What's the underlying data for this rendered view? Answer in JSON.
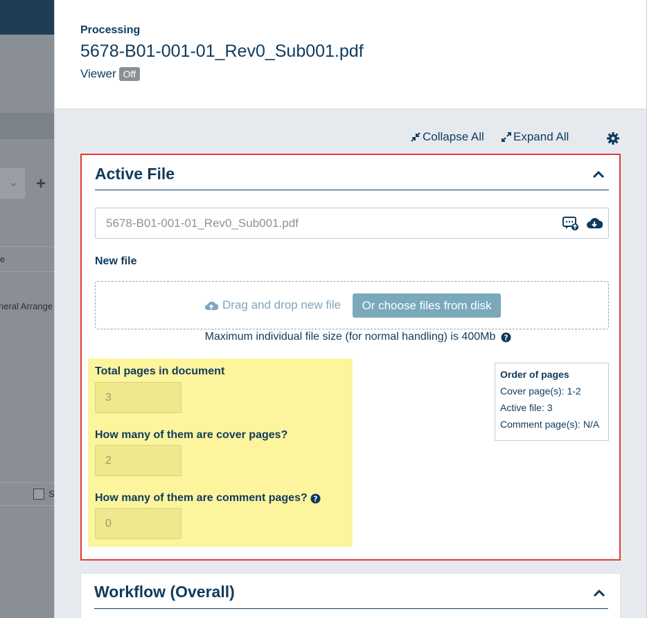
{
  "background": {
    "row_label_1": "e",
    "row_label_2": "neral Arrange",
    "checkbox_label": "S"
  },
  "header": {
    "section_label": "Processing",
    "file_title": "5678-B01-001-01_Rev0_Sub001.pdf",
    "viewer_label": "Viewer",
    "viewer_toggle": "Off"
  },
  "toolbar": {
    "collapse_all": "Collapse All",
    "expand_all": "Expand All"
  },
  "active_file": {
    "title": "Active File",
    "current_file_name": "5678-B01-001-01_Rev0_Sub001.pdf",
    "new_file_label": "New file",
    "drag_drop_text": "Drag and drop new file",
    "choose_button": "Or choose files from disk",
    "max_size_text": "Maximum individual file size (for normal handling) is 400Mb",
    "total_pages_label": "Total pages in document",
    "total_pages_value": "3",
    "cover_pages_label": "How many of them are cover pages?",
    "cover_pages_value": "2",
    "comment_pages_label": "How many of them are comment pages?",
    "comment_pages_value": "0",
    "order": {
      "title": "Order of pages",
      "cover": "Cover page(s): 1-2",
      "active": "Active file: 3",
      "comment": "Comment page(s): N/A"
    }
  },
  "workflow": {
    "title": "Workflow (Overall)"
  },
  "colors": {
    "primary_text": "#0f3a5c",
    "highlight": "#fcf59d",
    "outline": "#e53935",
    "button": "#79a9bb"
  }
}
